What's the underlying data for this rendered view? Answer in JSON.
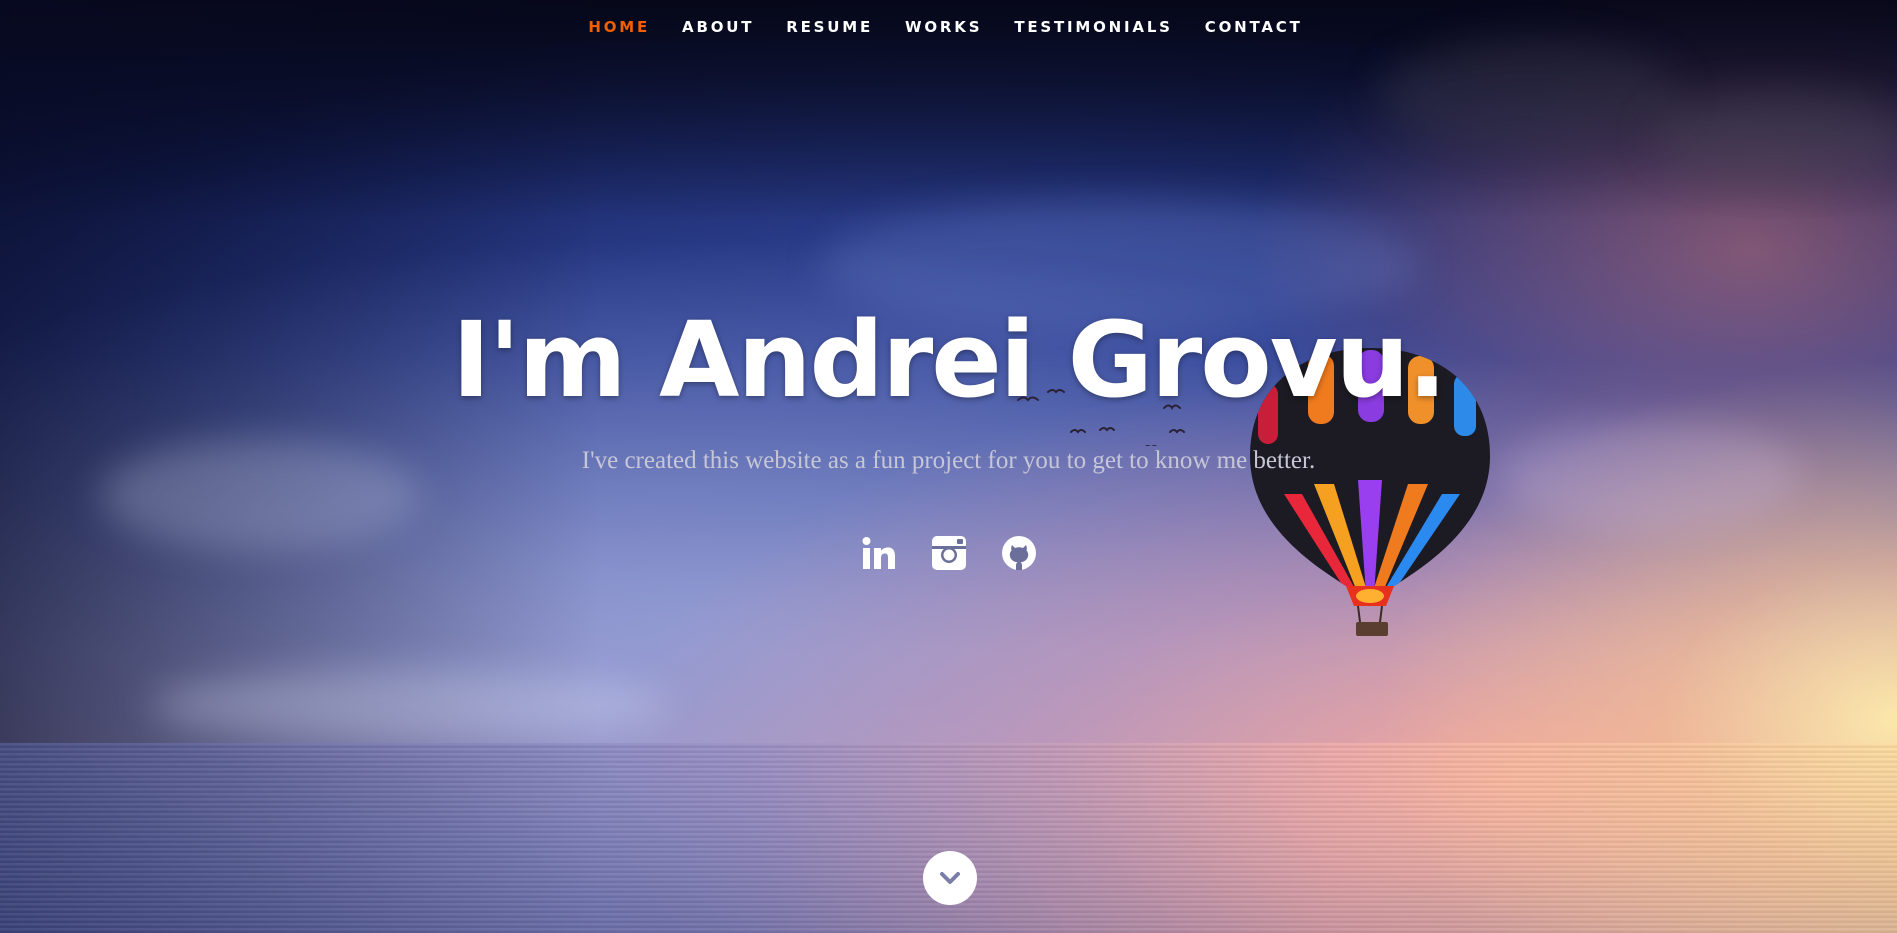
{
  "nav": {
    "items": [
      {
        "label": "HOME",
        "active": true
      },
      {
        "label": "ABOUT",
        "active": false
      },
      {
        "label": "RESUME",
        "active": false
      },
      {
        "label": "WORKS",
        "active": false
      },
      {
        "label": "TESTIMONIALS",
        "active": false
      },
      {
        "label": "CONTACT",
        "active": false
      }
    ],
    "active_color": "#f06000",
    "text_color": "#ffffff"
  },
  "hero": {
    "title": "I'm Andrei Grovu.",
    "subtitle": "I've created this website as a fun project for you to get to know me better."
  },
  "social": [
    {
      "icon": "linkedin-icon"
    },
    {
      "icon": "instagram-icon"
    },
    {
      "icon": "github-icon"
    }
  ],
  "scroll_down": {
    "icon": "chevron-down-icon"
  }
}
